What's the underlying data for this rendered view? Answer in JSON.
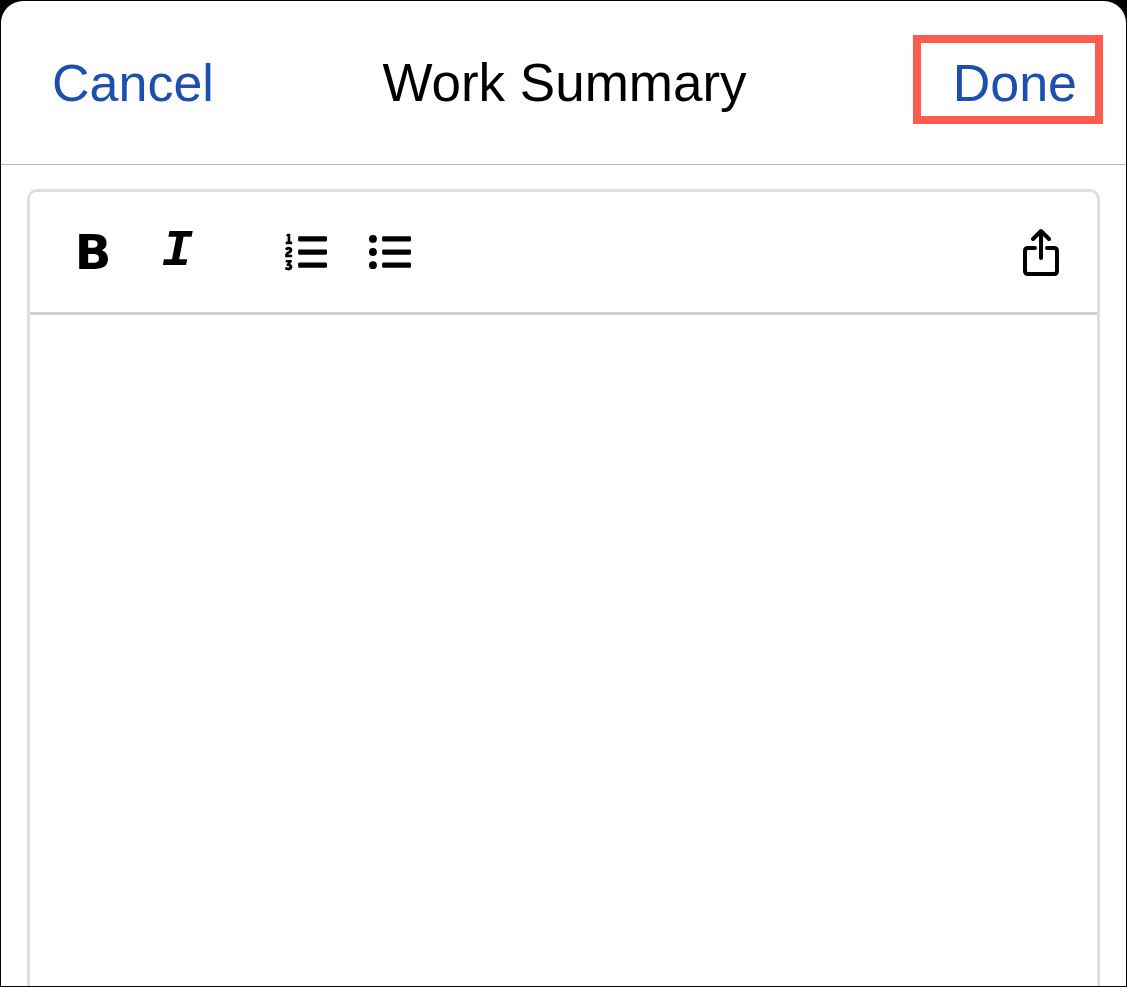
{
  "header": {
    "cancel": {
      "label": "Cancel"
    },
    "title": "Work Summary",
    "done": {
      "label": "Done",
      "highlighted": true
    }
  },
  "editor_toolbar": {
    "format": [
      {
        "kind": "bold",
        "label": "B"
      },
      {
        "kind": "italic",
        "label": "I"
      }
    ],
    "lists": [
      {
        "kind": "numbered"
      },
      {
        "kind": "bulleted"
      }
    ],
    "actions": [
      {
        "kind": "share"
      }
    ]
  }
}
